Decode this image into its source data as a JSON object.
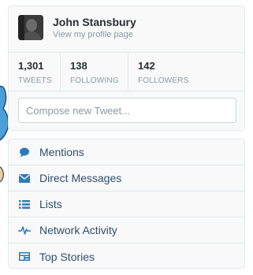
{
  "profile": {
    "name": "John Stansbury",
    "link_text": "View my profile page"
  },
  "stats": [
    {
      "value": "1,301",
      "label": "TWEETS"
    },
    {
      "value": "138",
      "label": "FOLLOWING"
    },
    {
      "value": "142",
      "label": "FOLLOWERS"
    }
  ],
  "compose": {
    "placeholder": "Compose new Tweet..."
  },
  "nav": {
    "items": [
      {
        "label": "Mentions",
        "icon": "speech-bubble-icon"
      },
      {
        "label": "Direct Messages",
        "icon": "envelope-icon"
      },
      {
        "label": "Lists",
        "icon": "list-icon"
      },
      {
        "label": "Network Activity",
        "icon": "activity-pulse-icon"
      },
      {
        "label": "Top Stories",
        "icon": "newspaper-icon"
      }
    ]
  },
  "colors": {
    "link": "#2d4f6e",
    "icon": "#2b7bb9",
    "mascot": "#55acee"
  }
}
